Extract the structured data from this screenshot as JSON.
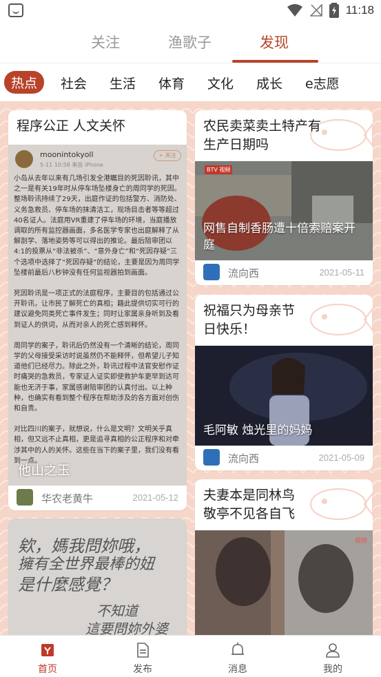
{
  "status_bar": {
    "time": "11:18"
  },
  "top_tabs": [
    {
      "label": "关注",
      "active": false
    },
    {
      "label": "渔歌子",
      "active": false
    },
    {
      "label": "发现",
      "active": true
    }
  ],
  "categories": [
    {
      "label": "热点",
      "active": true
    },
    {
      "label": "社会",
      "active": false
    },
    {
      "label": "生活",
      "active": false
    },
    {
      "label": "体育",
      "active": false
    },
    {
      "label": "文化",
      "active": false
    },
    {
      "label": "成长",
      "active": false
    },
    {
      "label": "e志愿",
      "active": false
    }
  ],
  "cards": {
    "left1": {
      "title": "程序公正   人文关怀",
      "author": "华农老黄牛",
      "date": "2021-05-12",
      "screenshot": {
        "username": "moonintokyoll",
        "meta": "5-11 10:58  来自 iPhone",
        "follow": "+ 关注",
        "paragraphs": [
          "小岛从去年以来有几场引发全港瞩目的死因聆讯，其中之一是有关19年时从停车场坠楼身亡的周同学的死因。整场聆讯持续了29天，出庭作证的包括警方、消防处、义务急救员、停车场的抹清洁工，现场目击者等等超过40名证人。法庭用VR重建了停车场的环境，当庭播放调取的所有监控器画面，多名医学专家也出庭解释了从解剖学、落地姿势等可以得出的推论。最后陪审团以4:1的投票从“非法被杀”、“意外身亡”和“死因存疑”三个选项中选择了“死因存疑”的结论，主要是因为周同学坠楼前最后八秒钟没有任何监视器拍到画面。",
          "死因聆讯是一项正式的法庭程序，主要目的包括通过公开聆讯，让市民了解死亡的真相；籍此提供切实可行的建议避免同类死亡事件发生；同时让家属亲身听到及看到证人的供词，从而对亲人的死亡感到释怀。",
          "周同学的案子，聆讯后仍然没有一个清晰的结论，周同学的父母接受采访时说虽然仍不能释怀，但希望儿子知道他们已经尽力。除此之外，聆讯过程中法官安慰作证时痛哭的急救员，专家证人证实即使救护车更早到达可能也无济于事，家属感谢陪审团的认真付出。以上种种，也确实有看到整个程序在帮助涉及的各方面对创伤和自责。",
          "对比四川的案子，就想说，什么是文明？文明关乎真相，但又远不止真相，更是追寻真相的公正程序和对牵涉其中的人的关怀。这些在当下的案子里，我们没有看到一点。"
        ],
        "watermark": "他山之玉"
      }
    },
    "left2": {
      "handwriting": [
        "欸，媽我問妳哦，",
        "擁有全世界最棒的妞",
        "是什麼感覺？",
        "不知道",
        "這要問妳外婆"
      ]
    },
    "right1": {
      "title": "农民卖菜卖土特产有生产日期吗",
      "caption": "网售自制香肠遭十倍索赔案开庭",
      "badge": "BTV 视频",
      "author": "流向西",
      "date": "2021-05-11"
    },
    "right2": {
      "title": "祝福只为母亲节日快乐！",
      "caption": "毛阿敏 烛光里的妈妈",
      "author": "流向西",
      "date": "2021-05-09"
    },
    "right3": {
      "title": "夫妻本是同林鸟敬亭不见各自飞",
      "badge": "视频"
    }
  },
  "bottom_nav": [
    {
      "label": "首页",
      "icon": "home-icon",
      "active": true
    },
    {
      "label": "发布",
      "icon": "publish-icon",
      "active": false
    },
    {
      "label": "消息",
      "icon": "bell-icon",
      "active": false
    },
    {
      "label": "我的",
      "icon": "profile-icon",
      "active": false
    }
  ],
  "colors": {
    "accent": "#b8432a",
    "feed_bg": "#f6d6c9",
    "nav_active": "#c0392b"
  }
}
